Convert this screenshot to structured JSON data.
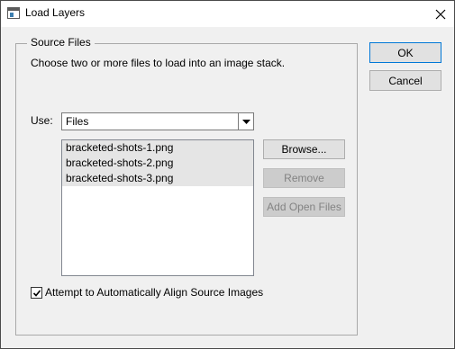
{
  "window": {
    "title": "Load Layers"
  },
  "source_files": {
    "group_label": "Source Files",
    "description": "Choose two or more files to load into an image stack.",
    "use_label": "Use:",
    "use_selected": "Files",
    "files": [
      "bracketed-shots-1.png",
      "bracketed-shots-2.png",
      "bracketed-shots-3.png"
    ],
    "browse_label": "Browse...",
    "remove_label": "Remove",
    "add_open_files_label": "Add Open Files",
    "align_checkbox_label": "Attempt to Automatically Align Source Images",
    "align_checked": true
  },
  "dialog_buttons": {
    "ok_label": "OK",
    "cancel_label": "Cancel"
  },
  "colors": {
    "window_bg": "#f0f0f0",
    "titlebar_bg": "#ffffff",
    "default_button_border": "#0078d7",
    "list_item_bg": "#e5e5e5",
    "disabled_text": "#838383"
  },
  "icons": {
    "app": "window-app-icon",
    "close": "close-icon",
    "dropdown": "chevron-down-icon",
    "check": "checkmark-icon"
  }
}
